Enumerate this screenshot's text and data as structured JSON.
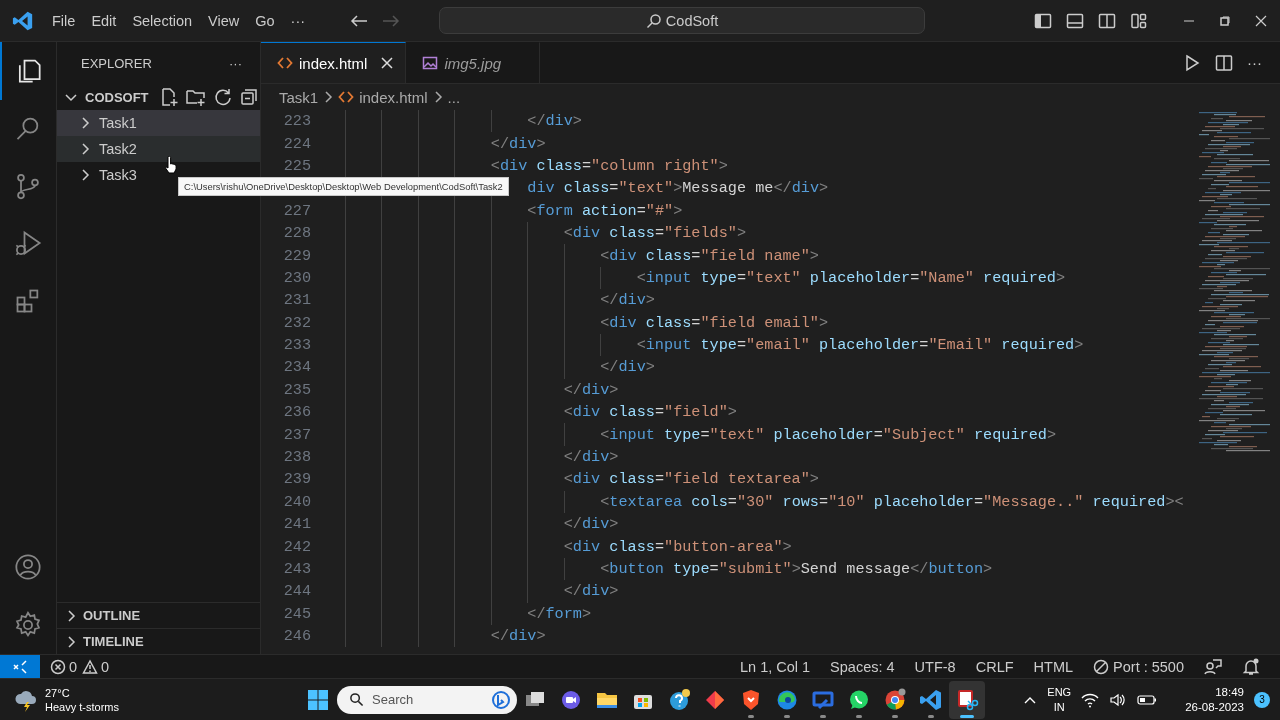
{
  "window": {
    "title": "CodSoft"
  },
  "menu": [
    "File",
    "Edit",
    "Selection",
    "View",
    "Go",
    "···"
  ],
  "nav": [
    {
      "kind": "back",
      "disabled": false
    },
    {
      "kind": "forward",
      "disabled": true
    }
  ],
  "activity_bar": [
    {
      "kind": "explorer",
      "selected": true
    },
    {
      "kind": "search",
      "selected": false
    },
    {
      "kind": "source-control",
      "selected": false
    },
    {
      "kind": "run",
      "selected": false
    },
    {
      "kind": "extensions",
      "selected": false
    }
  ],
  "activity_bottom": [
    {
      "kind": "accounts"
    },
    {
      "kind": "settings"
    }
  ],
  "sidebar": {
    "title": "EXPLORER",
    "more": "···",
    "folder": {
      "name": "CODSOFT",
      "expanded": true
    },
    "items": [
      {
        "label": "Task1",
        "selected": true,
        "hovered": false,
        "expanded": false
      },
      {
        "label": "Task2",
        "selected": false,
        "hovered": true,
        "expanded": false
      },
      {
        "label": "Task3",
        "selected": false,
        "hovered": false,
        "expanded": false
      }
    ],
    "sections": [
      {
        "label": "OUTLINE",
        "expanded": false
      },
      {
        "label": "TIMELINE",
        "expanded": false
      }
    ]
  },
  "tooltip": "C:\\Users\\rishu\\OneDrive\\Desktop\\Desktop\\Web Development\\CodSoft\\Task2",
  "tabs": [
    {
      "label": "index.html",
      "kind": "html",
      "selected": true,
      "preview": false
    },
    {
      "label": "img5.jpg",
      "kind": "image",
      "selected": false,
      "preview": true
    }
  ],
  "editor_more": "···",
  "breadcrumbs": [
    {
      "label": "Task1",
      "kind": "folder"
    },
    {
      "label": "index.html",
      "kind": "html"
    },
    {
      "label": "...",
      "kind": "more"
    }
  ],
  "code": [
    {
      "number": "223",
      "code": "                    </div>"
    },
    {
      "number": "224",
      "code": "                </div>"
    },
    {
      "number": "225",
      "code": "                <div class=\"column right\">"
    },
    {
      "code": "                    div class=\"text\">Message me</div>"
    },
    {
      "number": "227",
      "code": "                    <form action=\"#\">"
    },
    {
      "number": "228",
      "code": "                        <div class=\"fields\">"
    },
    {
      "number": "229",
      "code": "                            <div class=\"field name\">"
    },
    {
      "number": "230",
      "code": "                                <input type=\"text\" placeholder=\"Name\" required>"
    },
    {
      "number": "231",
      "code": "                            </div>"
    },
    {
      "number": "232",
      "code": "                            <div class=\"field email\">"
    },
    {
      "number": "233",
      "code": "                                <input type=\"email\" placeholder=\"Email\" required>"
    },
    {
      "number": "234",
      "code": "                            </div>"
    },
    {
      "number": "235",
      "code": "                        </div>"
    },
    {
      "number": "236",
      "code": "                        <div class=\"field\">"
    },
    {
      "number": "237",
      "code": "                            <input type=\"text\" placeholder=\"Subject\" required>"
    },
    {
      "number": "238",
      "code": "                        </div>"
    },
    {
      "number": "239",
      "code": "                        <div class=\"field textarea\">"
    },
    {
      "number": "240",
      "code": "                            <textarea cols=\"30\" rows=\"10\" placeholder=\"Message..\" required><"
    },
    {
      "number": "241",
      "code": "                        </div>"
    },
    {
      "number": "242",
      "code": "                        <div class=\"button-area\">"
    },
    {
      "number": "243",
      "code": "                            <button type=\"submit\">Send message</button>"
    },
    {
      "number": "244",
      "code": "                        </div>"
    },
    {
      "number": "245",
      "code": "                    </form>"
    },
    {
      "number": "246",
      "code": "                </div>"
    }
  ],
  "status_bar": {
    "errors": "0",
    "warnings": "0",
    "items": [
      {
        "label": "Ln 1, Col 1",
        "kind": "text"
      },
      {
        "label": "Spaces: 4",
        "kind": "text"
      },
      {
        "label": "UTF-8",
        "kind": "text"
      },
      {
        "label": "CRLF",
        "kind": "text"
      },
      {
        "label": "HTML",
        "kind": "text"
      },
      {
        "label": "Port : 5500",
        "kind": "port"
      }
    ]
  },
  "taskbar": {
    "weather": {
      "temp": "27°C",
      "condition": "Heavy t-storms"
    },
    "search": {
      "placeholder": "Search"
    },
    "apps": [
      {
        "kind": "task-view",
        "running": false,
        "selected": false
      },
      {
        "kind": "chat",
        "running": false,
        "selected": false
      },
      {
        "kind": "files",
        "running": false,
        "selected": false
      },
      {
        "kind": "store",
        "running": false,
        "selected": false
      },
      {
        "kind": "help",
        "running": false,
        "selected": false
      },
      {
        "kind": "diamond",
        "running": false,
        "selected": false
      },
      {
        "kind": "shield",
        "running": true,
        "selected": false
      },
      {
        "kind": "edge",
        "running": true,
        "selected": false
      },
      {
        "kind": "remote",
        "running": true,
        "selected": false
      },
      {
        "kind": "whatsapp",
        "running": true,
        "selected": false
      },
      {
        "kind": "chrome",
        "running": true,
        "selected": false
      },
      {
        "kind": "vscode",
        "running": true,
        "selected": false
      },
      {
        "kind": "snip",
        "running": true,
        "selected": true
      }
    ],
    "language": {
      "lang": "ENG",
      "region": "IN"
    },
    "time": "18:49",
    "date": "26-08-2023",
    "notifications": "3"
  }
}
